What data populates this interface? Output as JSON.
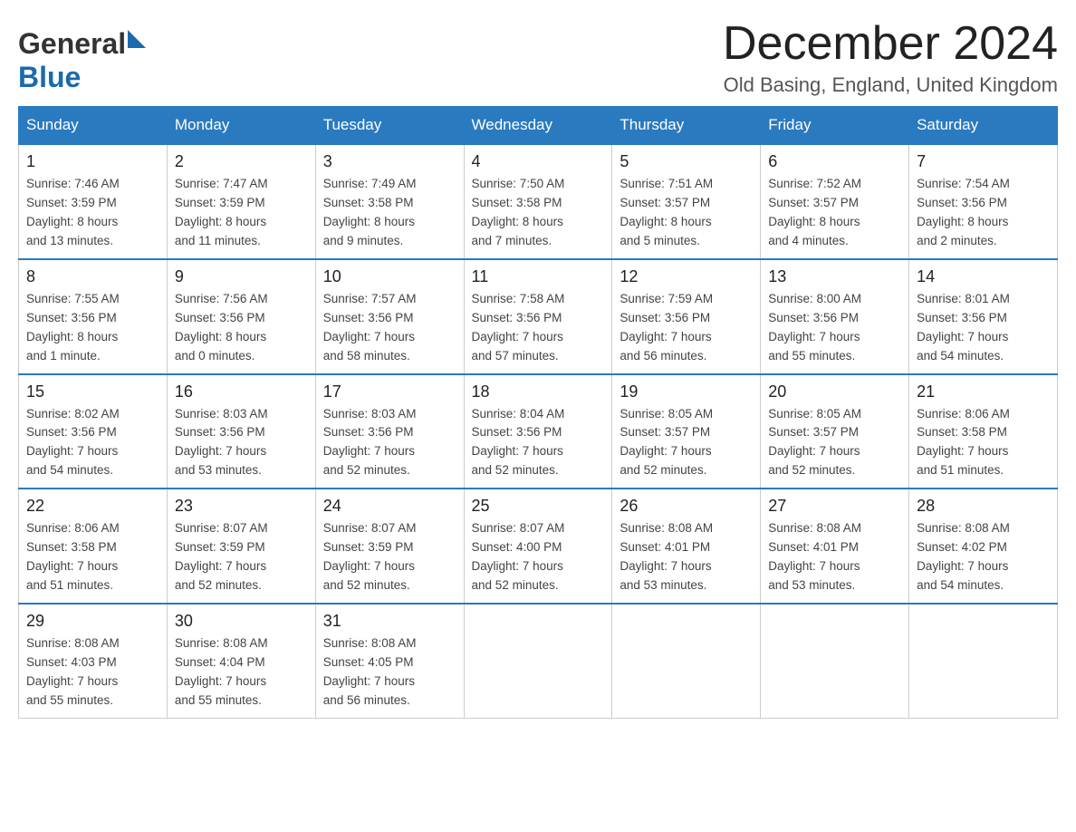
{
  "header": {
    "logo_general": "General",
    "logo_blue": "Blue",
    "month_title": "December 2024",
    "location": "Old Basing, England, United Kingdom"
  },
  "days_of_week": [
    "Sunday",
    "Monday",
    "Tuesday",
    "Wednesday",
    "Thursday",
    "Friday",
    "Saturday"
  ],
  "weeks": [
    [
      {
        "day": "1",
        "info": "Sunrise: 7:46 AM\nSunset: 3:59 PM\nDaylight: 8 hours\nand 13 minutes."
      },
      {
        "day": "2",
        "info": "Sunrise: 7:47 AM\nSunset: 3:59 PM\nDaylight: 8 hours\nand 11 minutes."
      },
      {
        "day": "3",
        "info": "Sunrise: 7:49 AM\nSunset: 3:58 PM\nDaylight: 8 hours\nand 9 minutes."
      },
      {
        "day": "4",
        "info": "Sunrise: 7:50 AM\nSunset: 3:58 PM\nDaylight: 8 hours\nand 7 minutes."
      },
      {
        "day": "5",
        "info": "Sunrise: 7:51 AM\nSunset: 3:57 PM\nDaylight: 8 hours\nand 5 minutes."
      },
      {
        "day": "6",
        "info": "Sunrise: 7:52 AM\nSunset: 3:57 PM\nDaylight: 8 hours\nand 4 minutes."
      },
      {
        "day": "7",
        "info": "Sunrise: 7:54 AM\nSunset: 3:56 PM\nDaylight: 8 hours\nand 2 minutes."
      }
    ],
    [
      {
        "day": "8",
        "info": "Sunrise: 7:55 AM\nSunset: 3:56 PM\nDaylight: 8 hours\nand 1 minute."
      },
      {
        "day": "9",
        "info": "Sunrise: 7:56 AM\nSunset: 3:56 PM\nDaylight: 8 hours\nand 0 minutes."
      },
      {
        "day": "10",
        "info": "Sunrise: 7:57 AM\nSunset: 3:56 PM\nDaylight: 7 hours\nand 58 minutes."
      },
      {
        "day": "11",
        "info": "Sunrise: 7:58 AM\nSunset: 3:56 PM\nDaylight: 7 hours\nand 57 minutes."
      },
      {
        "day": "12",
        "info": "Sunrise: 7:59 AM\nSunset: 3:56 PM\nDaylight: 7 hours\nand 56 minutes."
      },
      {
        "day": "13",
        "info": "Sunrise: 8:00 AM\nSunset: 3:56 PM\nDaylight: 7 hours\nand 55 minutes."
      },
      {
        "day": "14",
        "info": "Sunrise: 8:01 AM\nSunset: 3:56 PM\nDaylight: 7 hours\nand 54 minutes."
      }
    ],
    [
      {
        "day": "15",
        "info": "Sunrise: 8:02 AM\nSunset: 3:56 PM\nDaylight: 7 hours\nand 54 minutes."
      },
      {
        "day": "16",
        "info": "Sunrise: 8:03 AM\nSunset: 3:56 PM\nDaylight: 7 hours\nand 53 minutes."
      },
      {
        "day": "17",
        "info": "Sunrise: 8:03 AM\nSunset: 3:56 PM\nDaylight: 7 hours\nand 52 minutes."
      },
      {
        "day": "18",
        "info": "Sunrise: 8:04 AM\nSunset: 3:56 PM\nDaylight: 7 hours\nand 52 minutes."
      },
      {
        "day": "19",
        "info": "Sunrise: 8:05 AM\nSunset: 3:57 PM\nDaylight: 7 hours\nand 52 minutes."
      },
      {
        "day": "20",
        "info": "Sunrise: 8:05 AM\nSunset: 3:57 PM\nDaylight: 7 hours\nand 52 minutes."
      },
      {
        "day": "21",
        "info": "Sunrise: 8:06 AM\nSunset: 3:58 PM\nDaylight: 7 hours\nand 51 minutes."
      }
    ],
    [
      {
        "day": "22",
        "info": "Sunrise: 8:06 AM\nSunset: 3:58 PM\nDaylight: 7 hours\nand 51 minutes."
      },
      {
        "day": "23",
        "info": "Sunrise: 8:07 AM\nSunset: 3:59 PM\nDaylight: 7 hours\nand 52 minutes."
      },
      {
        "day": "24",
        "info": "Sunrise: 8:07 AM\nSunset: 3:59 PM\nDaylight: 7 hours\nand 52 minutes."
      },
      {
        "day": "25",
        "info": "Sunrise: 8:07 AM\nSunset: 4:00 PM\nDaylight: 7 hours\nand 52 minutes."
      },
      {
        "day": "26",
        "info": "Sunrise: 8:08 AM\nSunset: 4:01 PM\nDaylight: 7 hours\nand 53 minutes."
      },
      {
        "day": "27",
        "info": "Sunrise: 8:08 AM\nSunset: 4:01 PM\nDaylight: 7 hours\nand 53 minutes."
      },
      {
        "day": "28",
        "info": "Sunrise: 8:08 AM\nSunset: 4:02 PM\nDaylight: 7 hours\nand 54 minutes."
      }
    ],
    [
      {
        "day": "29",
        "info": "Sunrise: 8:08 AM\nSunset: 4:03 PM\nDaylight: 7 hours\nand 55 minutes."
      },
      {
        "day": "30",
        "info": "Sunrise: 8:08 AM\nSunset: 4:04 PM\nDaylight: 7 hours\nand 55 minutes."
      },
      {
        "day": "31",
        "info": "Sunrise: 8:08 AM\nSunset: 4:05 PM\nDaylight: 7 hours\nand 56 minutes."
      },
      {
        "day": "",
        "info": ""
      },
      {
        "day": "",
        "info": ""
      },
      {
        "day": "",
        "info": ""
      },
      {
        "day": "",
        "info": ""
      }
    ]
  ]
}
